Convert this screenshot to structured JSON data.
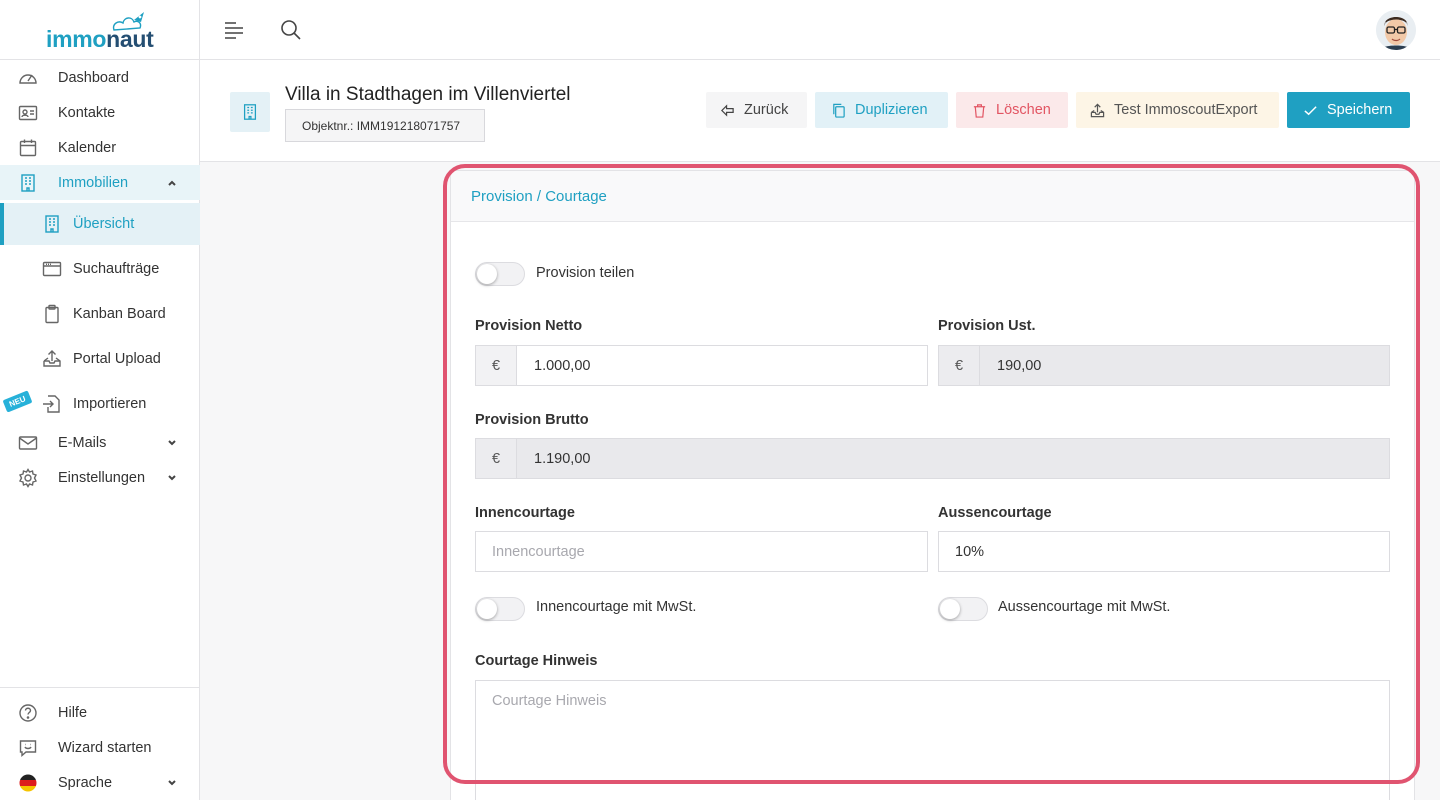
{
  "brand": {
    "part1": "immo",
    "part2": "naut"
  },
  "sidebar": {
    "items": [
      {
        "label": "Dashboard"
      },
      {
        "label": "Kontakte"
      },
      {
        "label": "Kalender"
      },
      {
        "label": "Immobilien"
      },
      {
        "label": "Übersicht"
      },
      {
        "label": "Suchaufträge"
      },
      {
        "label": "Kanban Board"
      },
      {
        "label": "Portal Upload"
      },
      {
        "label": "Importieren",
        "badge": "NEU"
      },
      {
        "label": "E-Mails"
      },
      {
        "label": "Einstellungen"
      }
    ],
    "bottom": [
      {
        "label": "Hilfe"
      },
      {
        "label": "Wizard starten"
      },
      {
        "label": "Sprache"
      }
    ]
  },
  "header": {
    "title": "Villa in Stadthagen im Villenviertel",
    "object_number": "Objektnr.: IMM191218071757",
    "buttons": {
      "back": "Zurück",
      "duplicate": "Duplizieren",
      "delete": "Löschen",
      "export": "Test ImmoscoutExport",
      "save": "Speichern"
    }
  },
  "card": {
    "title": "Provision / Courtage",
    "share_toggle": {
      "label": "Provision teilen",
      "on": false
    },
    "provision_netto": {
      "label": "Provision Netto",
      "prefix": "€",
      "value": "1.000,00"
    },
    "provision_ust": {
      "label": "Provision Ust.",
      "prefix": "€",
      "value": "190,00"
    },
    "provision_brutto": {
      "label": "Provision Brutto",
      "prefix": "€",
      "value": "1.190,00"
    },
    "innencourtage": {
      "label": "Innencourtage",
      "placeholder": "Innencourtage",
      "value": ""
    },
    "aussencourtage": {
      "label": "Aussencourtage",
      "value": "10%"
    },
    "innen_mwst_toggle": {
      "label": "Innencourtage mit MwSt.",
      "on": false
    },
    "aussen_mwst_toggle": {
      "label": "Aussencourtage mit MwSt.",
      "on": false
    },
    "hinweis": {
      "label": "Courtage Hinweis",
      "placeholder": "Courtage Hinweis"
    }
  },
  "colors": {
    "accent": "#1fa0c2",
    "brand_dark": "#244e72",
    "danger": "#e25563",
    "highlight": "#e05470"
  }
}
